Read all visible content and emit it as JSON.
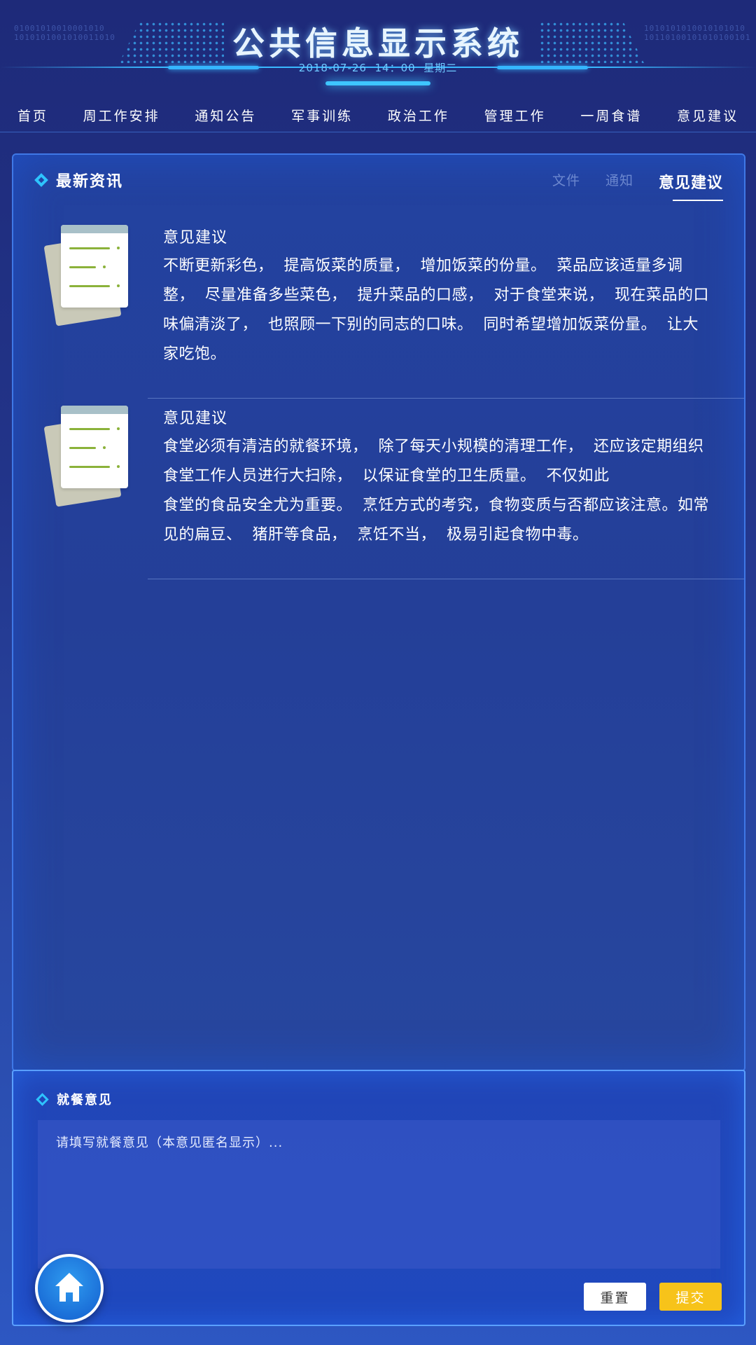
{
  "header": {
    "title": "公共信息显示系统",
    "datetime": "2018-07-26  14：00  星期二",
    "binary_left": "01001010010001010\n1010101001010011010",
    "binary_right": "1010101010010101010\n10110100101010100101"
  },
  "nav": {
    "items": [
      {
        "label": "首页"
      },
      {
        "label": "周工作安排"
      },
      {
        "label": "通知公告"
      },
      {
        "label": "军事训练"
      },
      {
        "label": "政治工作"
      },
      {
        "label": "管理工作"
      },
      {
        "label": "一周食谱"
      },
      {
        "label": "意见建议"
      }
    ]
  },
  "panel": {
    "title": "最新资讯",
    "tabs": [
      {
        "label": "文件",
        "active": false
      },
      {
        "label": "通知",
        "active": false
      },
      {
        "label": "意见建议",
        "active": true
      }
    ],
    "items": [
      {
        "icon": "document-icon",
        "title": "意见建议",
        "body": "不断更新彩色，  提高饭菜的质量，  增加饭菜的份量。  菜品应该适量多调整，  尽量准备多些菜色，  提升菜品的口感，  对于食堂来说，  现在菜品的口味偏清淡了，  也照顾一下别的同志的口味。  同时希望增加饭菜份量。  让大家吃饱。"
      },
      {
        "icon": "document-icon",
        "title": "意见建议",
        "body": "食堂必须有清洁的就餐环境，  除了每天小规模的清理工作，  还应该定期组织食堂工作人员进行大扫除，  以保证食堂的卫生质量。  不仅如此\n食堂的食品安全尤为重要。  烹饪方式的考究，食物变质与否都应该注意。如常见的扁豆、  猪肝等食品，  烹饪不当，  极易引起食物中毒。"
      }
    ]
  },
  "feedback": {
    "title": "就餐意见",
    "placeholder": "请填写就餐意见（本意见匿名显示）...",
    "value": "",
    "reset_label": "重置",
    "submit_label": "提交"
  },
  "colors": {
    "accent": "#2ec4ff",
    "submit": "#f7c31a",
    "panel_border": "#3f78e6",
    "list_line": "#8bb23a"
  },
  "icons": {
    "home": "home-icon",
    "section": "diamond-icon",
    "document": "document-icon"
  }
}
